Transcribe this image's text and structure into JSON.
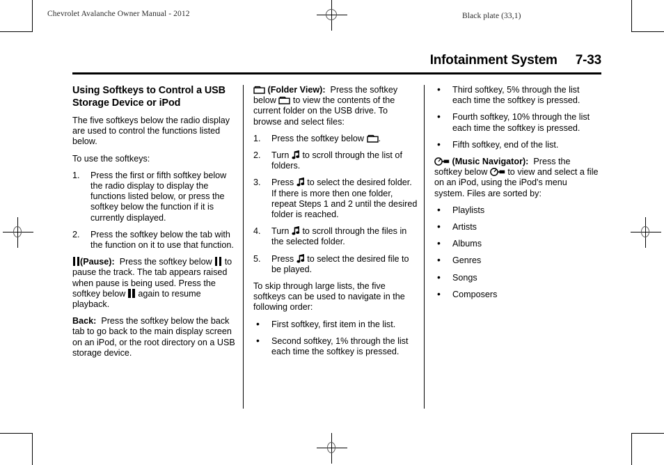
{
  "slug": {
    "left": "Chevrolet Avalanche Owner Manual - 2012",
    "right": "Black plate (33,1)"
  },
  "header": {
    "title": "Infotainment System",
    "page_number": "7-33"
  },
  "column1": {
    "section_title": "Using Softkeys to Control a USB Storage Device or iPod",
    "intro": "The five softkeys below the radio display are used to control the functions listed below.",
    "lead_in": "To use the softkeys:",
    "steps": [
      {
        "marker": "1.",
        "text": "Press the first or fifth softkey below the radio display to display the functions listed below, or press the softkey below the function if it is currently displayed."
      },
      {
        "marker": "2.",
        "text": "Press the softkey below the tab with the function on it to use that function."
      }
    ],
    "pause_label": "(Pause):",
    "pause_text_a": "Press the softkey below",
    "pause_text_b": "to pause the track. The tab appears raised when pause is being used. Press the softkey below",
    "pause_text_c": "again to resume playback.",
    "back_label": "Back:",
    "back_text": "Press the softkey below the back tab to go back to the main display screen on an iPod, or the root directory on a USB storage device."
  },
  "column2": {
    "folder_label": "(Folder View):",
    "folder_text_a": "Press the softkey below",
    "folder_text_b": "to view the contents of the current folder on the USB drive. To browse and select files:",
    "steps": [
      {
        "marker": "1.",
        "text_a": "Press the softkey below",
        "text_b": "."
      },
      {
        "marker": "2.",
        "text_a": "Turn",
        "text_b": "to scroll through the list of folders."
      },
      {
        "marker": "3.",
        "text_a": "Press",
        "text_b": "to select the desired folder. If there is more then one folder, repeat Steps 1 and 2 until the desired folder is reached."
      },
      {
        "marker": "4.",
        "text_a": "Turn",
        "text_b": "to scroll through the files in the selected folder."
      },
      {
        "marker": "5.",
        "text_a": "Press",
        "text_b": "to select the desired file to be played."
      }
    ],
    "skip_text": "To skip through large lists, the five softkeys can be used to navigate in the following order:",
    "bullets": [
      "First softkey, first item in the list.",
      "Second softkey, 1% through the list each time the softkey is pressed."
    ]
  },
  "column3": {
    "bullets_top": [
      "Third softkey, 5% through the list each time the softkey is pressed.",
      "Fourth softkey, 10% through the list each time the softkey is pressed.",
      "Fifth softkey, end of the list."
    ],
    "navigator_label": "(Music Navigator):",
    "navigator_text_a": "Press the softkey below",
    "navigator_text_b": "to view and select a file on an iPod, using the iPod's menu system. Files are sorted by:",
    "sorted_by": [
      "Playlists",
      "Artists",
      "Albums",
      "Genres",
      "Songs",
      "Composers"
    ]
  },
  "icons": {
    "pause": "pause-icon",
    "folder": "folder-view-icon",
    "note": "music-note-icon",
    "navigator": "music-navigator-icon",
    "registration": "registration-mark"
  },
  "colors": {
    "text": "#000000",
    "rule": "#000000",
    "slug": "#2a2a2a",
    "paper": "#ffffff"
  }
}
